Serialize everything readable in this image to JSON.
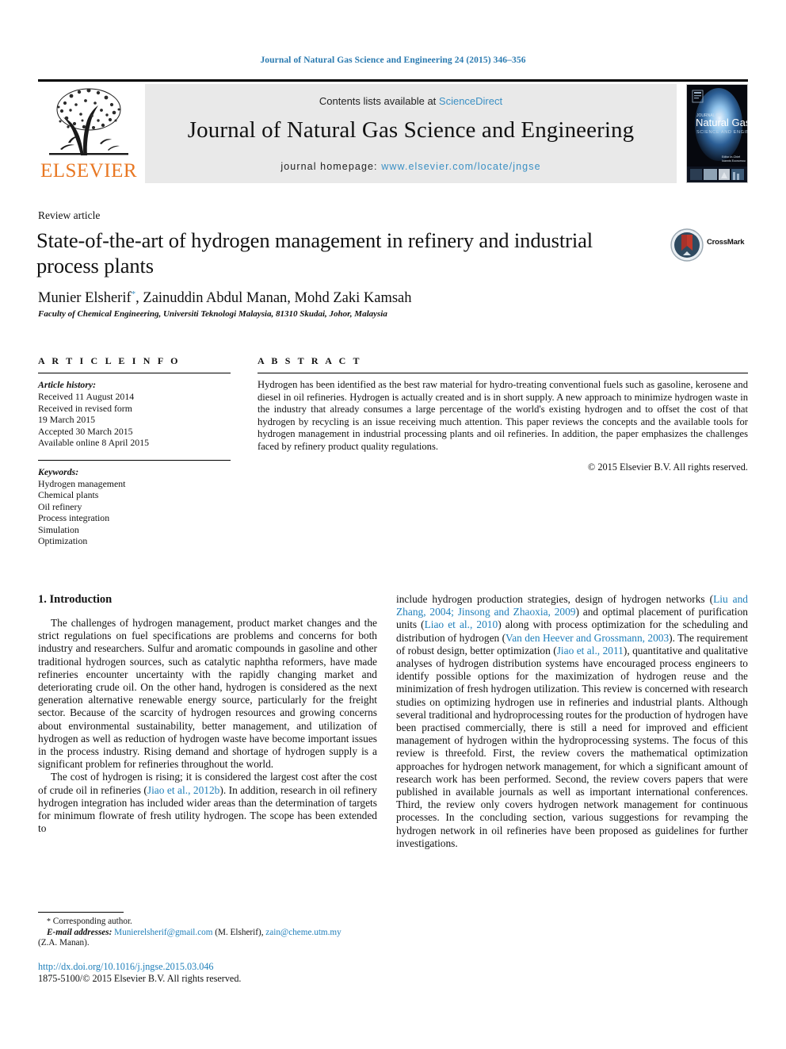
{
  "running_head": "Journal of Natural Gas Science and Engineering 24 (2015) 346–356",
  "masthead": {
    "contents_prefix": "Contents lists available at ",
    "sciencedirect": "ScienceDirect",
    "journal_name": "Journal of Natural Gas Science and Engineering",
    "homepage_prefix": "journal homepage: ",
    "homepage_url": "www.elsevier.com/locate/jngse",
    "publisher_wordmark": "ELSEVIER",
    "publisher_logo_icon": "elsevier-tree-icon",
    "cover_icon": "journal-cover-thumbnail",
    "cover_title_line1": "Natural Gas",
    "cover_title_line2": "SCIENCE AND ENGINEERING"
  },
  "article": {
    "type_label": "Review article",
    "title": "State-of-the-art of hydrogen management in refinery and industrial process plants",
    "authors_part1": "Munier Elsherif",
    "authors_star": "*",
    "authors_part2": ", Zainuddin Abdul Manan, Mohd Zaki Kamsah",
    "affiliation": "Faculty of Chemical Engineering, Universiti Teknologi Malaysia, 81310 Skudai, Johor, Malaysia",
    "crossmark_label": "CrossMark",
    "crossmark_icon": "crossmark-icon"
  },
  "article_info": {
    "heading": "A R T I C L E   I N F O",
    "history_label": "Article history:",
    "history": [
      "Received 11 August 2014",
      "Received in revised form",
      "19 March 2015",
      "Accepted 30 March 2015",
      "Available online 8 April 2015"
    ],
    "keywords_label": "Keywords:",
    "keywords": [
      "Hydrogen management",
      "Chemical plants",
      "Oil refinery",
      "Process integration",
      "Simulation",
      "Optimization"
    ]
  },
  "abstract": {
    "heading": "A B S T R A C T",
    "text": "Hydrogen has been identified as the best raw material for hydro-treating conventional fuels such as gasoline, kerosene and diesel in oil refineries. Hydrogen is actually created and is in short supply. A new approach to minimize hydrogen waste in the industry that already consumes a large percentage of the world's existing hydrogen and to offset the cost of that hydrogen by recycling is an issue receiving much attention. This paper reviews the concepts and the available tools for hydrogen management in industrial processing plants and oil refineries. In addition, the paper emphasizes the challenges faced by refinery product quality regulations.",
    "copyright": "© 2015 Elsevier B.V. All rights reserved."
  },
  "body": {
    "section_heading": "1. Introduction",
    "left_p1": "The challenges of hydrogen management, product market changes and the strict regulations on fuel specifications are problems and concerns for both industry and researchers. Sulfur and aromatic compounds in gasoline and other traditional hydrogen sources, such as catalytic naphtha reformers, have made refineries encounter uncertainty with the rapidly changing market and deteriorating crude oil. On the other hand, hydrogen is considered as the next generation alternative renewable energy source, particularly for the freight sector. Because of the scarcity of hydrogen resources and growing concerns about environmental sustainability, better management, and utilization of hydrogen as well as reduction of hydrogen waste have become important issues in the process industry. Rising demand and shortage of hydrogen supply is a significant problem for refineries throughout the world.",
    "left_p2_a": "The cost of hydrogen is rising; it is considered the largest cost after the cost of crude oil in refineries (",
    "left_p2_cite1": "Jiao et al., 2012b",
    "left_p2_b": "). In addition, research in oil refinery hydrogen integration has included wider areas than the determination of targets for minimum flowrate of fresh utility hydrogen. The scope has been extended to",
    "right_a": "include hydrogen production strategies, design of hydrogen networks (",
    "right_cite1": "Liu and Zhang, 2004; Jinsong and Zhaoxia, 2009",
    "right_b": ") and optimal placement of purification units (",
    "right_cite2": "Liao et al., 2010",
    "right_c": ") along with process optimization for the scheduling and distribution of hydrogen (",
    "right_cite3": "Van den Heever and Grossmann, 2003",
    "right_d": "). The requirement of robust design, better optimization (",
    "right_cite4": "Jiao et al., 2011",
    "right_e": "), quantitative and qualitative analyses of hydrogen distribution systems have encouraged process engineers to identify possible options for the maximization of hydrogen reuse and the minimization of fresh hydrogen utilization. This review is concerned with research studies on optimizing hydrogen use in refineries and industrial plants. Although several traditional and hydroprocessing routes for the production of hydrogen have been practised commercially, there is still a need for improved and efficient management of hydrogen within the hydroprocessing systems. The focus of this review is threefold. First, the review covers the mathematical optimization approaches for hydrogen network management, for which a significant amount of research work has been performed. Second, the review covers papers that were published in available journals as well as important international conferences. Third, the review only covers hydrogen network management for continuous processes. In the concluding section, various suggestions for revamping the hydrogen network in oil refineries have been proposed as guidelines for further investigations."
  },
  "footnote": {
    "star": "*",
    "corresponding": " Corresponding author.",
    "email_label": "E-mail addresses:",
    "email1": "Munierelsherif@gmail.com",
    "email1_owner": " (M. Elsherif), ",
    "email2": "zain@cheme.utm.my",
    "email2_owner": "(Z.A. Manan)."
  },
  "footer": {
    "doi": "http://dx.doi.org/10.1016/j.jngse.2015.03.046",
    "issn": "1875-5100/© 2015 Elsevier B.V. All rights reserved."
  },
  "colors": {
    "link": "#1f7fba",
    "header_blue": "#2a7ab0",
    "elsevier_orange": "#E87722",
    "masthead_grey": "#e9e9e9"
  }
}
